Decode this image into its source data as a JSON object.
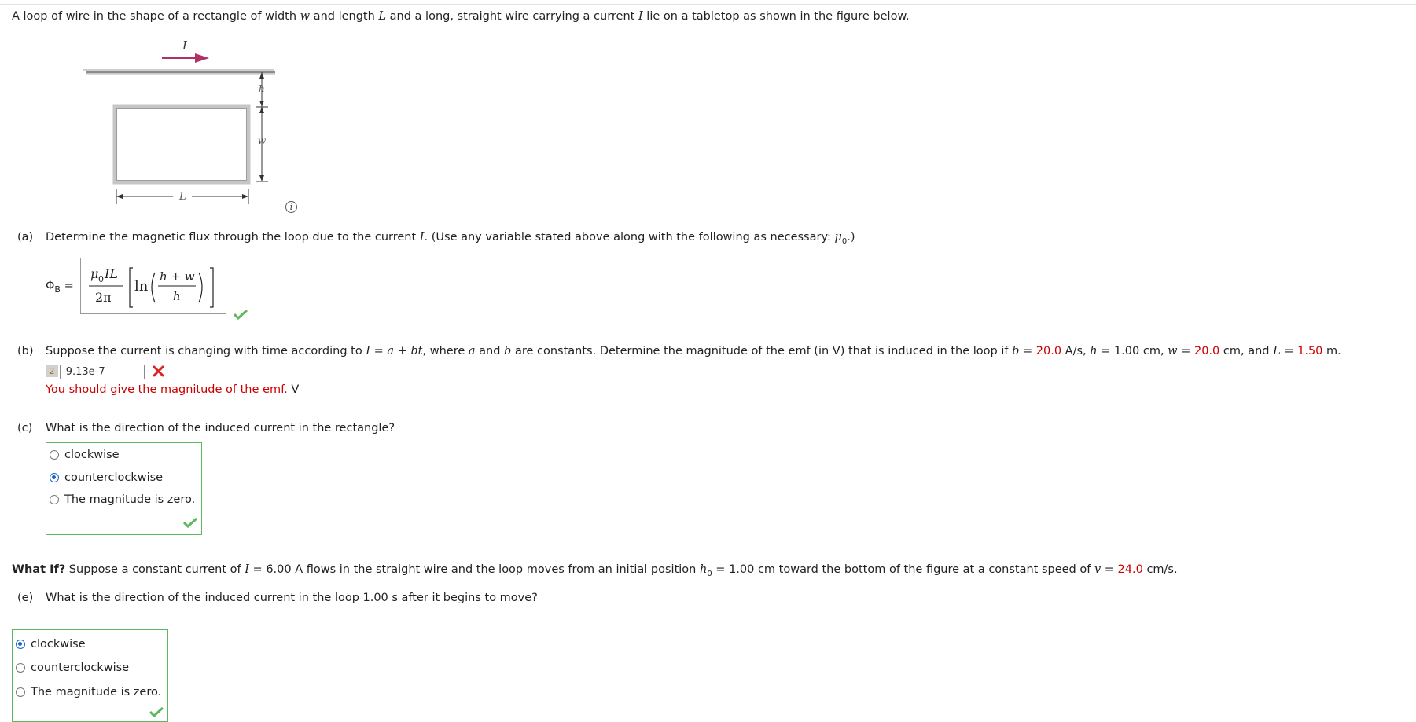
{
  "intro": {
    "p1": "A loop of wire in the shape of a rectangle of width ",
    "w": "w",
    "p2": " and length ",
    "L": "L",
    "p3": " and a long, straight wire carrying a current ",
    "I": "I",
    "p4": " lie on a tabletop as shown in the figure below."
  },
  "figure": {
    "current_label": "I",
    "h_label": "h",
    "w_label": "w",
    "L_label": "L",
    "info_icon": "i"
  },
  "part_a": {
    "label": "(a)",
    "text1": "Determine the magnetic flux through the loop due to the current ",
    "I": "I",
    "text2": ". (Use any variable stated above along with the following as necessary: ",
    "mu": "μ",
    "mu_sub": "0",
    "text3": ".)",
    "phi": "Φ",
    "phi_sub": "B",
    "equals": "=",
    "formula": {
      "num_mu": "μ",
      "num_sub": "0",
      "num_rest": "IL",
      "den": "2π",
      "ln": "ln",
      "inner_num": "h + w",
      "inner_den": "h"
    },
    "status": "correct"
  },
  "part_b": {
    "label": "(b)",
    "t1": "Suppose the current is changing with time according to ",
    "eq": "I = a + bt",
    "t2": ", where ",
    "a": "a",
    "t3": " and ",
    "b": "b",
    "t4": " are constants. Determine the magnitude of the emf (in V) that is induced in the loop if ",
    "b2": "b",
    "t5": " = ",
    "b_val": "20.0",
    "t6": " A/s, ",
    "h": "h",
    "t7": " = 1.00 cm, ",
    "w": "w",
    "t8": " = ",
    "w_val": "20.0",
    "t9": " cm, and ",
    "L": "L",
    "t10": " = ",
    "L_val": "1.50",
    "t11": " m.",
    "attempts": "2",
    "answer": "-9.13e-7",
    "status": "incorrect",
    "feedback": "You should give the magnitude of the emf.",
    "unit": "V"
  },
  "part_c": {
    "label": "(c)",
    "question": "What is the direction of the induced current in the rectangle?",
    "options": [
      "clockwise",
      "counterclockwise",
      "The magnitude is zero."
    ],
    "selected": 1,
    "status": "correct"
  },
  "what_if": {
    "bold": "What If?",
    "t1": " Suppose a constant current of ",
    "I": "I",
    "t2": " = 6.00 A flows in the straight wire and the loop moves from an initial position ",
    "h": "h",
    "h_sub": "0",
    "t3": " = 1.00 cm toward the bottom of the figure at a constant speed of ",
    "v": "v",
    "t4": " = ",
    "v_val": "24.0",
    "t5": " cm/s."
  },
  "part_e": {
    "label": "(e)",
    "question": "What is the direction of the induced current in the loop 1.00 s after it begins to move?",
    "options": [
      "clockwise",
      "counterclockwise",
      "The magnitude is zero."
    ],
    "selected": 0,
    "status": "correct"
  },
  "colors": {
    "correct": "#5cb85c",
    "incorrect": "#dd2222",
    "highlight": "#cc0000",
    "arrow": "#b0306a",
    "selected_radio": "#1a66cc"
  }
}
